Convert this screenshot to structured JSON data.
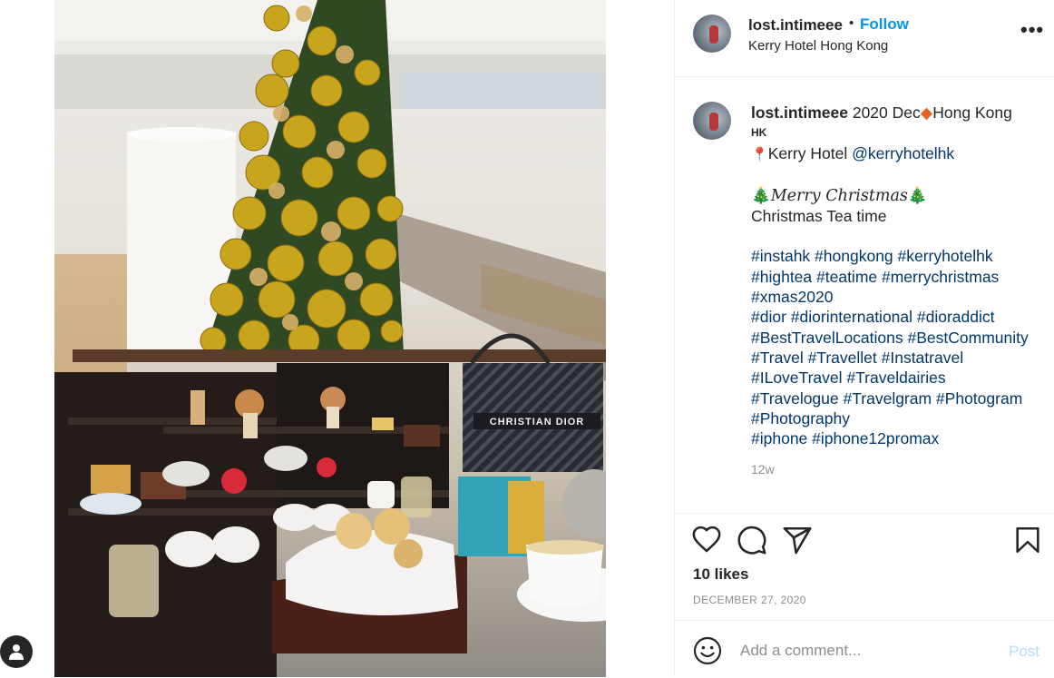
{
  "post": {
    "username": "lost.intimeee",
    "separator": "•",
    "follow_label": "Follow",
    "location": "Kerry Hotel Hong Kong"
  },
  "caption": {
    "username": "lost.intimeee",
    "line1_text": " 2020 Dec",
    "line1_place": "Hong Kong",
    "line1_small": "HK",
    "line2_text": "Kerry Hotel ",
    "line2_mention": "@kerryhotelhk",
    "line3_text": "Merry Christmas",
    "line4_text": "Christmas Tea time",
    "hashtag_lines": [
      "#instahk #hongkong #kerryhotelhk",
      "#hightea #teatime #merrychristmas",
      "#xmas2020",
      "#dior #diorinternational #dioraddict",
      "#BestTravelLocations #BestCommunity",
      "#Travel #Travellet #Instatravel",
      "#ILoveTravel #Traveldairies",
      "#Travelogue #Travelgram #Photogram",
      "#Photography",
      "#iphone #iphone12promax"
    ],
    "time_ago": "12w"
  },
  "engagement": {
    "likes": "10 likes",
    "date": "DECEMBER 27, 2020"
  },
  "comment": {
    "placeholder": "Add a comment...",
    "post_label": "Post"
  },
  "photo": {
    "bag_text": "CHRISTIAN DIOR"
  },
  "icons": {
    "like": "heart-icon",
    "comment": "comment-bubble-icon",
    "share": "paper-plane-icon",
    "save": "bookmark-icon",
    "more": "more-options-icon",
    "emoji": "smiley-icon"
  },
  "colors": {
    "link": "#0095f6",
    "hashtag": "#00376b",
    "muted": "#8e8e8e",
    "post_disabled": "#b2dffc"
  }
}
